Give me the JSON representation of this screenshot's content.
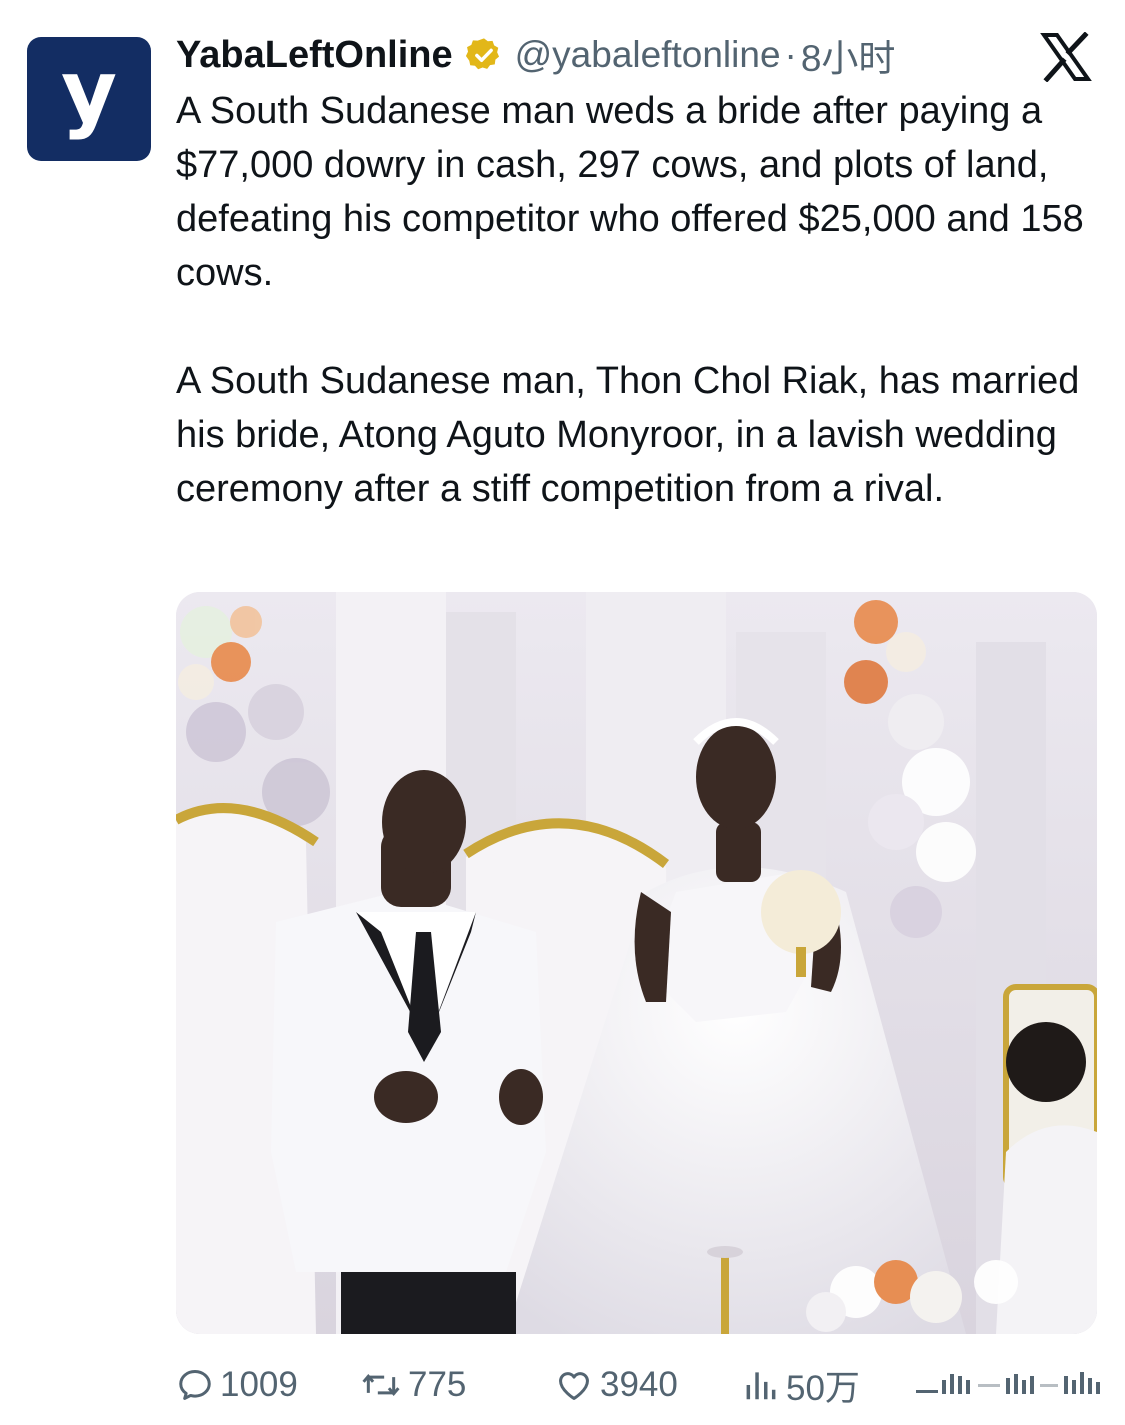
{
  "author": {
    "avatar_letter": "y",
    "name": "YabaLeftOnline",
    "handle": "@yabaleftonline",
    "separator": "·",
    "time": "8小时"
  },
  "tweet": {
    "paragraph_1": "A South Sudanese man weds a bride after paying a $77,000 dowry in cash, 297 cows, and plots of land, defeating his competitor who offered $25,000 and 158 cows.",
    "paragraph_2": "A South Sudanese man, Thon Chol Riak, has married his bride, Atong Aguto Monyroor, in a lavish wedding ceremony after a stiff competition from a rival."
  },
  "actions": {
    "replies": "1009",
    "retweets": "775",
    "likes": "3940",
    "views": "50万"
  },
  "colors": {
    "brand": "#132d63",
    "verified": "#e2b719",
    "muted": "#536471",
    "text": "#0f1419"
  },
  "icons": [
    "x-logo-icon",
    "verified-badge-icon",
    "reply-icon",
    "retweet-icon",
    "like-icon",
    "views-icon"
  ]
}
